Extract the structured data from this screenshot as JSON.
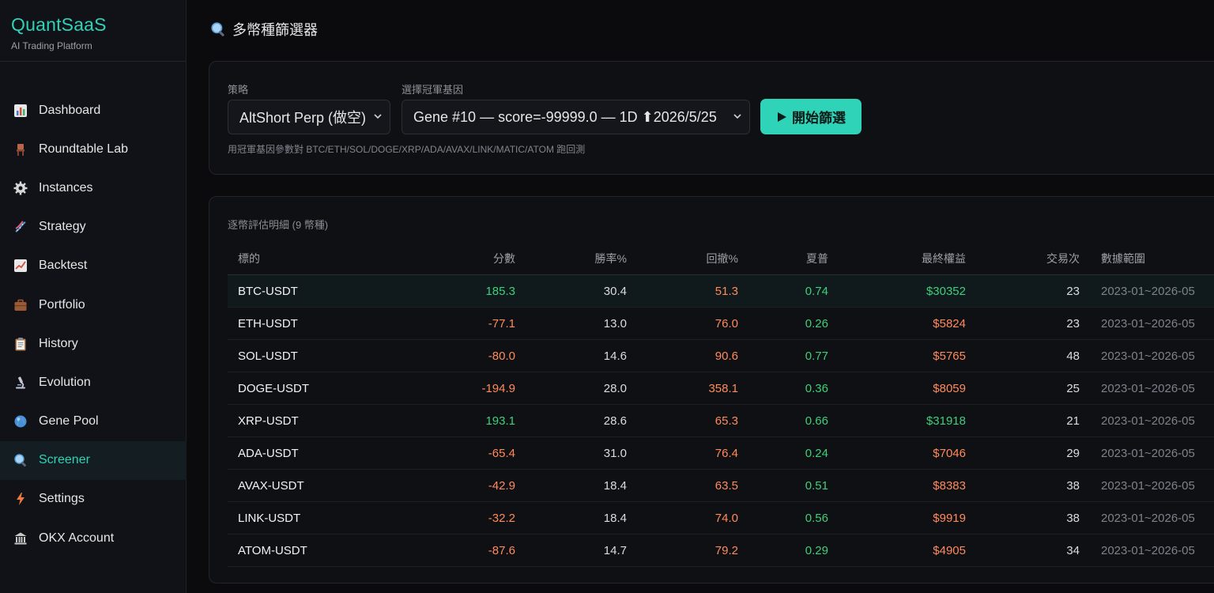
{
  "app": {
    "name": "QuantSaaS",
    "subtitle": "AI Trading Platform"
  },
  "sidebar": {
    "items": [
      {
        "label": "Dashboard",
        "icon": "bar-chart-icon",
        "active": false
      },
      {
        "label": "Roundtable Lab",
        "icon": "chair-icon",
        "active": false
      },
      {
        "label": "Instances",
        "icon": "gear-icon",
        "active": false
      },
      {
        "label": "Strategy",
        "icon": "dna-icon",
        "active": false
      },
      {
        "label": "Backtest",
        "icon": "line-chart-icon",
        "active": false
      },
      {
        "label": "Portfolio",
        "icon": "briefcase-icon",
        "active": false
      },
      {
        "label": "History",
        "icon": "clipboard-icon",
        "active": false
      },
      {
        "label": "Evolution",
        "icon": "microscope-icon",
        "active": false
      },
      {
        "label": "Gene Pool",
        "icon": "globe-icon",
        "active": false
      },
      {
        "label": "Screener",
        "icon": "magnifier-icon",
        "active": true
      },
      {
        "label": "Settings",
        "icon": "lightning-icon",
        "active": false
      },
      {
        "label": "OKX Account",
        "icon": "bank-icon",
        "active": false
      }
    ]
  },
  "header": {
    "title": "多幣種篩選器",
    "icon": "magnifier-icon"
  },
  "config": {
    "strategy_label": "策略",
    "strategy_value": "AltShort Perp (做空)",
    "gene_label": "選擇冠軍基因",
    "gene_value": "Gene #10 — score=-99999.0 — 1D ⬆2026/5/25",
    "run_label": "開始篩選",
    "hint": "用冠軍基因參數對 BTC/ETH/SOL/DOGE/XRP/ADA/AVAX/LINK/MATIC/ATOM 跑回測"
  },
  "results": {
    "title": "逐幣評估明細 (9 幣種)",
    "columns": [
      "標的",
      "分數",
      "勝率%",
      "回撤%",
      "夏普",
      "最終權益",
      "交易次",
      "數據範圍"
    ],
    "rows": [
      {
        "symbol": "BTC-USDT",
        "score": "185.3",
        "winrate": "30.4",
        "drawdown": "51.3",
        "sharpe": "0.74",
        "equity": "$30352",
        "trades": "23",
        "range": "2023-01~2026-05"
      },
      {
        "symbol": "ETH-USDT",
        "score": "-77.1",
        "winrate": "13.0",
        "drawdown": "76.0",
        "sharpe": "0.26",
        "equity": "$5824",
        "trades": "23",
        "range": "2023-01~2026-05"
      },
      {
        "symbol": "SOL-USDT",
        "score": "-80.0",
        "winrate": "14.6",
        "drawdown": "90.6",
        "sharpe": "0.77",
        "equity": "$5765",
        "trades": "48",
        "range": "2023-01~2026-05"
      },
      {
        "symbol": "DOGE-USDT",
        "score": "-194.9",
        "winrate": "28.0",
        "drawdown": "358.1",
        "sharpe": "0.36",
        "equity": "$8059",
        "trades": "25",
        "range": "2023-01~2026-05"
      },
      {
        "symbol": "XRP-USDT",
        "score": "193.1",
        "winrate": "28.6",
        "drawdown": "65.3",
        "sharpe": "0.66",
        "equity": "$31918",
        "trades": "21",
        "range": "2023-01~2026-05"
      },
      {
        "symbol": "ADA-USDT",
        "score": "-65.4",
        "winrate": "31.0",
        "drawdown": "76.4",
        "sharpe": "0.24",
        "equity": "$7046",
        "trades": "29",
        "range": "2023-01~2026-05"
      },
      {
        "symbol": "AVAX-USDT",
        "score": "-42.9",
        "winrate": "18.4",
        "drawdown": "63.5",
        "sharpe": "0.51",
        "equity": "$8383",
        "trades": "38",
        "range": "2023-01~2026-05"
      },
      {
        "symbol": "LINK-USDT",
        "score": "-32.2",
        "winrate": "18.4",
        "drawdown": "74.0",
        "sharpe": "0.56",
        "equity": "$9919",
        "trades": "38",
        "range": "2023-01~2026-05"
      },
      {
        "symbol": "ATOM-USDT",
        "score": "-87.6",
        "winrate": "14.7",
        "drawdown": "79.2",
        "sharpe": "0.29",
        "equity": "$4905",
        "trades": "34",
        "range": "2023-01~2026-05"
      }
    ]
  },
  "colors": {
    "accent": "#2fd3b7",
    "positive": "#3fcf7a",
    "negative": "#ff8a5c"
  }
}
